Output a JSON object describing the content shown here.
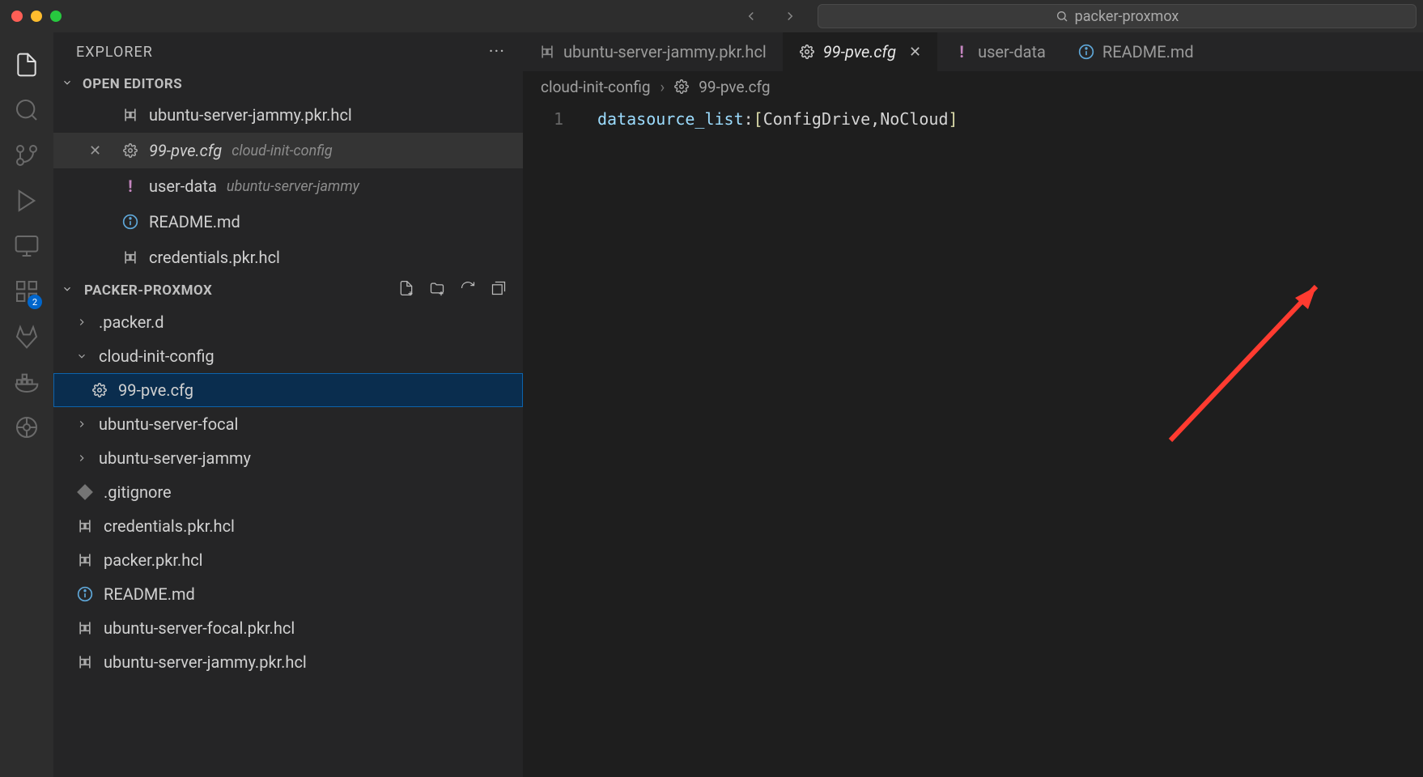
{
  "search_placeholder": "packer-proxmox",
  "sidebar_badge": "2",
  "explorer": {
    "title": "EXPLORER",
    "open_editors": "OPEN EDITORS",
    "project": "PACKER-PROXMOX"
  },
  "openEditors": [
    {
      "name": "ubuntu-server-jammy.pkr.hcl",
      "sub": ""
    },
    {
      "name": "99-pve.cfg",
      "sub": "cloud-init-config",
      "active": true
    },
    {
      "name": "user-data",
      "sub": "ubuntu-server-jammy"
    },
    {
      "name": "README.md",
      "sub": ""
    },
    {
      "name": "credentials.pkr.hcl",
      "sub": ""
    }
  ],
  "tree": {
    "packer_d": ".packer.d",
    "cloud_init": "cloud-init-config",
    "pve_cfg": "99-pve.cfg",
    "focal": "ubuntu-server-focal",
    "jammy": "ubuntu-server-jammy",
    "gitignore": ".gitignore",
    "cred": "credentials.pkr.hcl",
    "packer": "packer.pkr.hcl",
    "readme": "README.md",
    "focal_hcl": "ubuntu-server-focal.pkr.hcl",
    "jammy_hcl": "ubuntu-server-jammy.pkr.hcl"
  },
  "tabs": [
    {
      "name": "ubuntu-server-jammy.pkr.hcl"
    },
    {
      "name": "99-pve.cfg",
      "active": true
    },
    {
      "name": "user-data"
    },
    {
      "name": "README.md"
    }
  ],
  "breadcrumb": {
    "p0": "cloud-init-config",
    "p1": "99-pve.cfg"
  },
  "editor": {
    "line_no": "1",
    "key": "datasource_list",
    "colon": ":",
    "sp": " ",
    "lbrk": "[",
    "v1": "ConfigDrive",
    "comma": ",",
    "sp2": " ",
    "v2": "NoCloud",
    "rbrk": "]"
  }
}
